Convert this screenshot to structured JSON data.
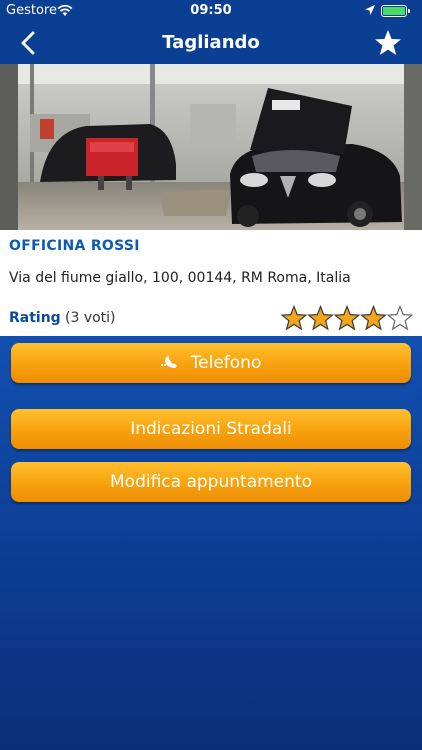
{
  "status_bar": {
    "carrier": "Gestore",
    "time": "09:50",
    "battery_level": 1.0
  },
  "nav": {
    "title": "Tagliando"
  },
  "shop": {
    "name": "OFFICINA ROSSI",
    "address": "Via del fiume giallo, 100, 00144, RM Roma, Italia",
    "rating_label": "Rating",
    "votes": "(3 voti)",
    "rating_value": 4,
    "rating_max": 5
  },
  "actions": {
    "phone_label": "Telefono",
    "directions_label": "Indicazioni Stradali",
    "edit_label": "Modifica appuntamento"
  },
  "colors": {
    "header": "#0b3f94",
    "accent": "#f7a10d",
    "link_blue": "#0b5cb3"
  }
}
